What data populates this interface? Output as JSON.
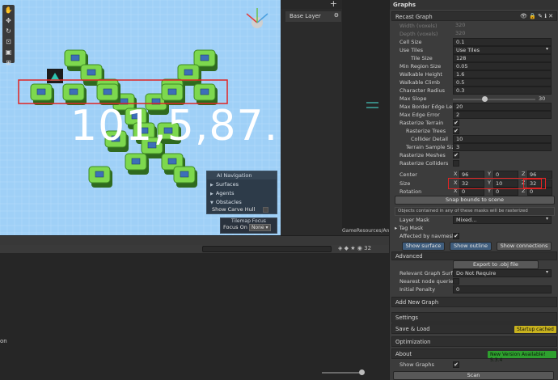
{
  "scene": {
    "overlay_label": "101,5,87.5",
    "ai_navigation": {
      "title": "AI Navigation",
      "items": [
        "Surfaces",
        "Agents",
        "Obstacles"
      ]
    },
    "show_carve_hull": "Show Carve Hull",
    "tilemap_focus": {
      "title": "Tilemap Focus",
      "focus_on_label": "Focus On",
      "focus_value": "None"
    }
  },
  "hierarchy": {
    "plus": "+",
    "base_layer": "Base Layer"
  },
  "project": {
    "resource_path": "GameResources/Anim",
    "count_badge": "32"
  },
  "console": {
    "left_text": "on"
  },
  "inspector": {
    "title": "Graphs",
    "recast_graph": "Recast Graph",
    "width_voxels": {
      "label": "Width (voxels)",
      "value": "320"
    },
    "depth_voxels": {
      "label": "Depth (voxels)",
      "value": "320"
    },
    "cell_size": {
      "label": "Cell Size",
      "value": "0.1"
    },
    "use_tiles": {
      "label": "Use Tiles",
      "value": "Use Tiles"
    },
    "tile_size": {
      "label": "Tile Size",
      "value": "128"
    },
    "min_region_size": {
      "label": "Min Region Size",
      "value": "0.05"
    },
    "walkable_height": {
      "label": "Walkable Height",
      "value": "1.6"
    },
    "walkable_climb": {
      "label": "Walkable Climb",
      "value": "0.5"
    },
    "character_radius": {
      "label": "Character Radius",
      "value": "0.3"
    },
    "max_slope": {
      "label": "Max Slope",
      "value": "30"
    },
    "max_border_edge_length": {
      "label": "Max Border Edge Length",
      "value": "20"
    },
    "max_edge_error": {
      "label": "Max Edge Error",
      "value": "2"
    },
    "rasterize_terrain": {
      "label": "Rasterize Terrain",
      "value": "✔"
    },
    "rasterize_trees": {
      "label": "Rasterize Trees",
      "value": "✔"
    },
    "collider_detail": {
      "label": "Collider Detail",
      "value": "10"
    },
    "terrain_sample_size": {
      "label": "Terrain Sample Size",
      "value": "3"
    },
    "rasterize_meshes": {
      "label": "Rasterize Meshes",
      "value": "✔"
    },
    "rasterize_colliders": {
      "label": "Rasterize Colliders",
      "value": ""
    },
    "center": {
      "label": "Center",
      "x": "96",
      "y": "0",
      "z": "96"
    },
    "size": {
      "label": "Size",
      "x": "32",
      "y": "10",
      "z": "32"
    },
    "rotation": {
      "label": "Rotation",
      "x": "0",
      "y": "0",
      "z": "0"
    },
    "axis": {
      "x": "X",
      "y": "Y",
      "z": "Z"
    },
    "snap_bounds": "Snap bounds to scene",
    "mask_note": "Objects contained in any of these masks will be rasterized",
    "layer_mask": {
      "label": "Layer Mask",
      "value": "Mixed..."
    },
    "tag_mask": "Tag Mask",
    "affected_by_navmesh": {
      "label": "Affected by navmesh c",
      "value": "✔"
    },
    "show_surface": "Show surface",
    "show_outline": "Show outline",
    "show_connections": "Show connections",
    "advanced": "Advanced",
    "export_obj": "Export to .obj file",
    "relevant_graph_surface": {
      "label": "Relevant Graph Surfac",
      "value": "Do Not Require"
    },
    "nearest_node_queries": {
      "label": "Nearest node queries i",
      "value": ""
    },
    "initial_penalty": {
      "label": "Initial Penalty",
      "value": "0"
    },
    "add_new_graph": "Add New Graph",
    "settings": "Settings",
    "save_load": "Save & Load",
    "startup_cached": "Startup cached",
    "optimization": "Optimization",
    "about": "About",
    "new_version": "New Version Available! 5.3.4",
    "show_graphs": {
      "label": "Show Graphs",
      "value": "✔"
    },
    "scan": "Scan",
    "colors": {
      "startup_badge": "#c8b21e",
      "version_badge": "#2ea02e"
    }
  }
}
